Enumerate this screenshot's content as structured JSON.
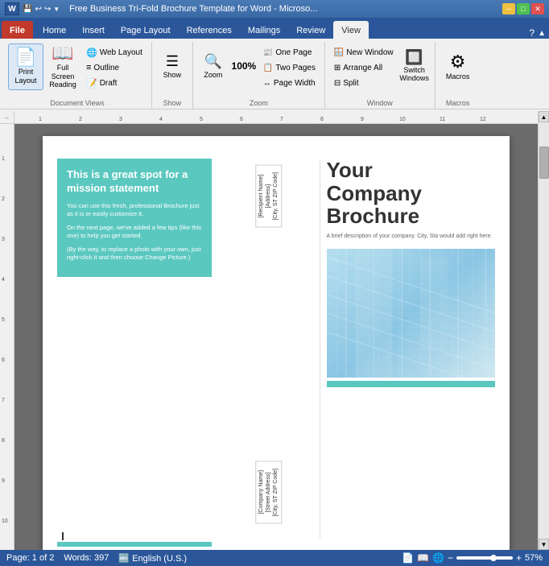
{
  "titlebar": {
    "title": "Free Business Tri-Fold Brochure Template for Word - Microsо...",
    "word_icon_label": "W",
    "quick_access": [
      "save",
      "undo",
      "redo",
      "customize"
    ]
  },
  "ribbon_tabs": [
    "File",
    "Home",
    "Insert",
    "Page Layout",
    "References",
    "Mailings",
    "Review",
    "View"
  ],
  "active_tab": "View",
  "ribbon_groups": {
    "document_views": {
      "label": "Document Views",
      "buttons": {
        "print_layout": "Print\nLayout",
        "full_screen": "Full Screen\nReading",
        "web_layout": "Web Layout",
        "outline": "Outline",
        "draft": "Draft"
      }
    },
    "show": {
      "label": "Show",
      "btn": "Show"
    },
    "zoom": {
      "label": "Zoom",
      "zoom_btn": "Zoom",
      "zoom_value": "100%",
      "one_page": "One\nPage",
      "two_pages": "Two\nPages",
      "page_width": "Page\nWidth"
    },
    "window": {
      "label": "Window",
      "new_window": "New Window",
      "arrange_all": "Arrange All",
      "split": "Split",
      "switch_windows": "Switch\nWindows"
    },
    "macros": {
      "label": "Macros",
      "macros_btn": "Macros"
    }
  },
  "brochure": {
    "left_panel": {
      "teal_title": "This is a great spot for a mission statement",
      "body1": "You can use this fresh, professional Brochure just as it is or easily customize it.",
      "body2": "On the next page, we've added a few tips (like this one) to help you get started.",
      "body3": "(By the way, to replace a photo with your own, just right-click it and then choose Change Picture.)"
    },
    "middle_panel": {
      "address1": "[Recipient Name]",
      "address2": "[Address]",
      "address3": "[City, ST ZIP Code]",
      "sender1": "[Company Name]",
      "sender2": "[Street Address]",
      "sender3": "[City, ST ZIP Code]"
    },
    "right_panel": {
      "company_line1": "Your",
      "company_line2": "Company",
      "company_line3": "Brochure",
      "subtitle": "A brief description of your company. City, Sta would add right here."
    }
  },
  "statusbar": {
    "page": "Page: 1 of 2",
    "words": "Words: 397",
    "language": "English (U.S.)",
    "zoom": "57%"
  }
}
